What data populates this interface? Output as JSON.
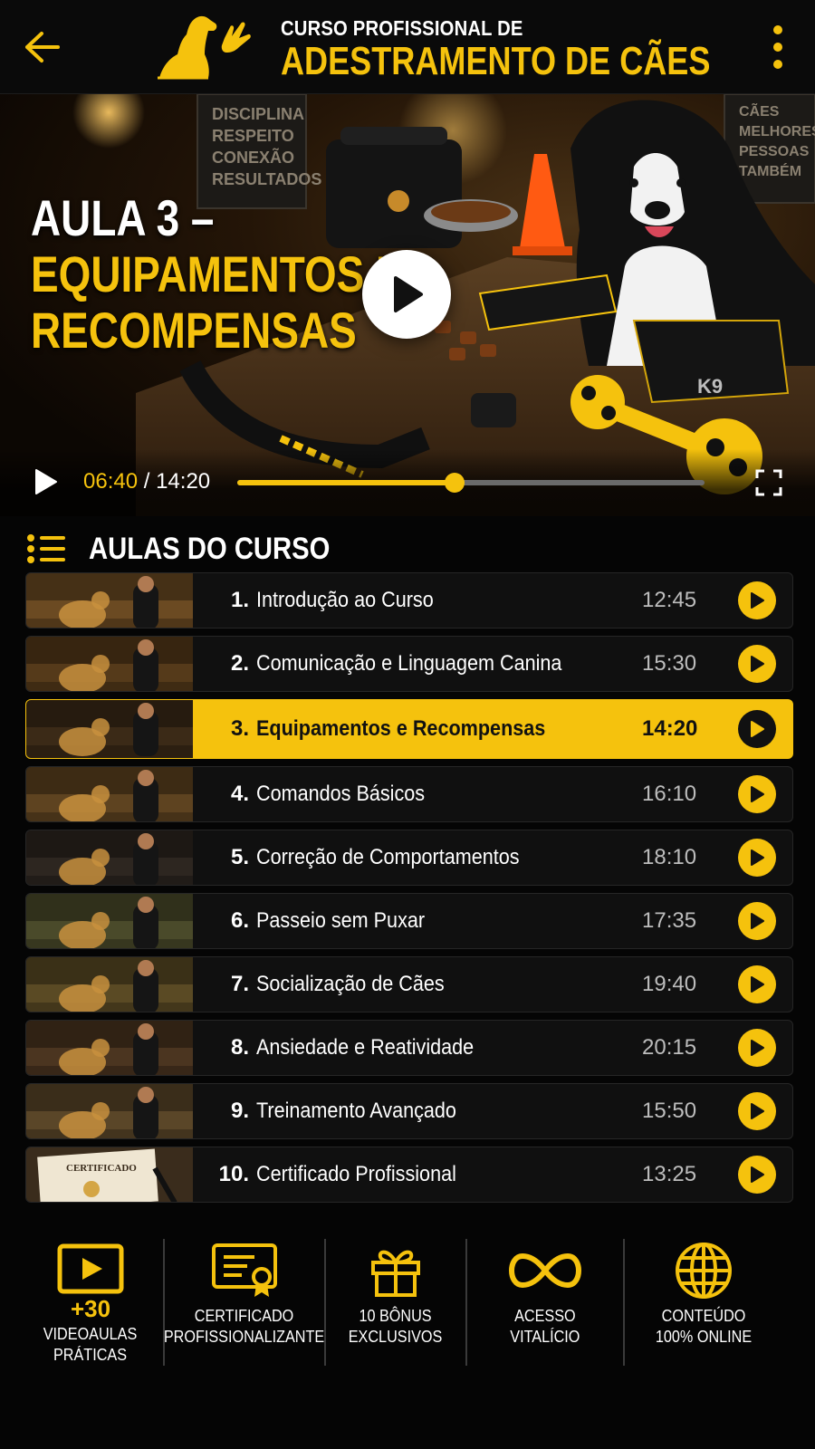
{
  "header": {
    "title_small": "CURSO PROFISSIONAL DE",
    "title_big": "ADESTRAMENTO DE CÃES"
  },
  "video": {
    "title_line1": "AULA 3 –",
    "title_line2": "EQUIPAMENTOS E",
    "title_line3": "RECOMPENSAS",
    "current_time": "06:40",
    "separator": " / ",
    "total_time": "14:20",
    "progress": 0.466,
    "signs": {
      "left": [
        "DISCIPLINA",
        "RESPEITO",
        "CONEXÃO",
        "RESULTADOS"
      ],
      "right": [
        "CÃES",
        "MELHORES",
        "PESSOAS",
        "TAMBÉM"
      ]
    },
    "harness_text": "K9"
  },
  "lessons_section": {
    "title": "AULAS DO CURSO",
    "active_index": 2,
    "items": [
      {
        "number": "1.",
        "title": "Introdução ao Curso",
        "duration": "12:45",
        "thumb": "#6b4a22"
      },
      {
        "number": "2.",
        "title": "Comunicação e Linguagem Canina",
        "duration": "15:30",
        "thumb": "#553a1a"
      },
      {
        "number": "3.",
        "title": "Equipamentos e Recompensas",
        "duration": "14:20",
        "thumb": "#3b2a17"
      },
      {
        "number": "4.",
        "title": "Comandos Básicos",
        "duration": "16:10",
        "thumb": "#5e4320"
      },
      {
        "number": "5.",
        "title": "Correção de Comportamentos",
        "duration": "18:10",
        "thumb": "#2d2620"
      },
      {
        "number": "6.",
        "title": "Passeio sem Puxar",
        "duration": "17:35",
        "thumb": "#4a4a2a"
      },
      {
        "number": "7.",
        "title": "Socialização de Cães",
        "duration": "19:40",
        "thumb": "#5a4a24"
      },
      {
        "number": "8.",
        "title": "Ansiedade e Reatividade",
        "duration": "20:15",
        "thumb": "#4b3520"
      },
      {
        "number": "9.",
        "title": "Treinamento Avançado",
        "duration": "15:50",
        "thumb": "#5a4628"
      },
      {
        "number": "10.",
        "title": "Certificado Profissional",
        "duration": "13:25",
        "thumb": "#6d5638"
      }
    ],
    "certificate_thumb_text": "CERTIFICADO"
  },
  "features": [
    {
      "icon": "video-play-icon",
      "strong": "+30",
      "line1": "VIDEOAULAS",
      "line2": "PRÁTICAS"
    },
    {
      "icon": "certificate-icon",
      "strong": "",
      "line1": "CERTIFICADO",
      "line2": "PROFISSIONALIZANTE"
    },
    {
      "icon": "gift-icon",
      "strong": "",
      "line1": "10 BÔNUS",
      "line2": "EXCLUSIVOS"
    },
    {
      "icon": "infinity-icon",
      "strong": "",
      "line1": "ACESSO",
      "line2": "VITALÍCIO"
    },
    {
      "icon": "globe-icon",
      "strong": "",
      "line1": "CONTEÚDO",
      "line2": "100% ONLINE"
    }
  ],
  "colors": {
    "accent": "#f5c20d",
    "background": "#050505",
    "row": "#101010"
  }
}
